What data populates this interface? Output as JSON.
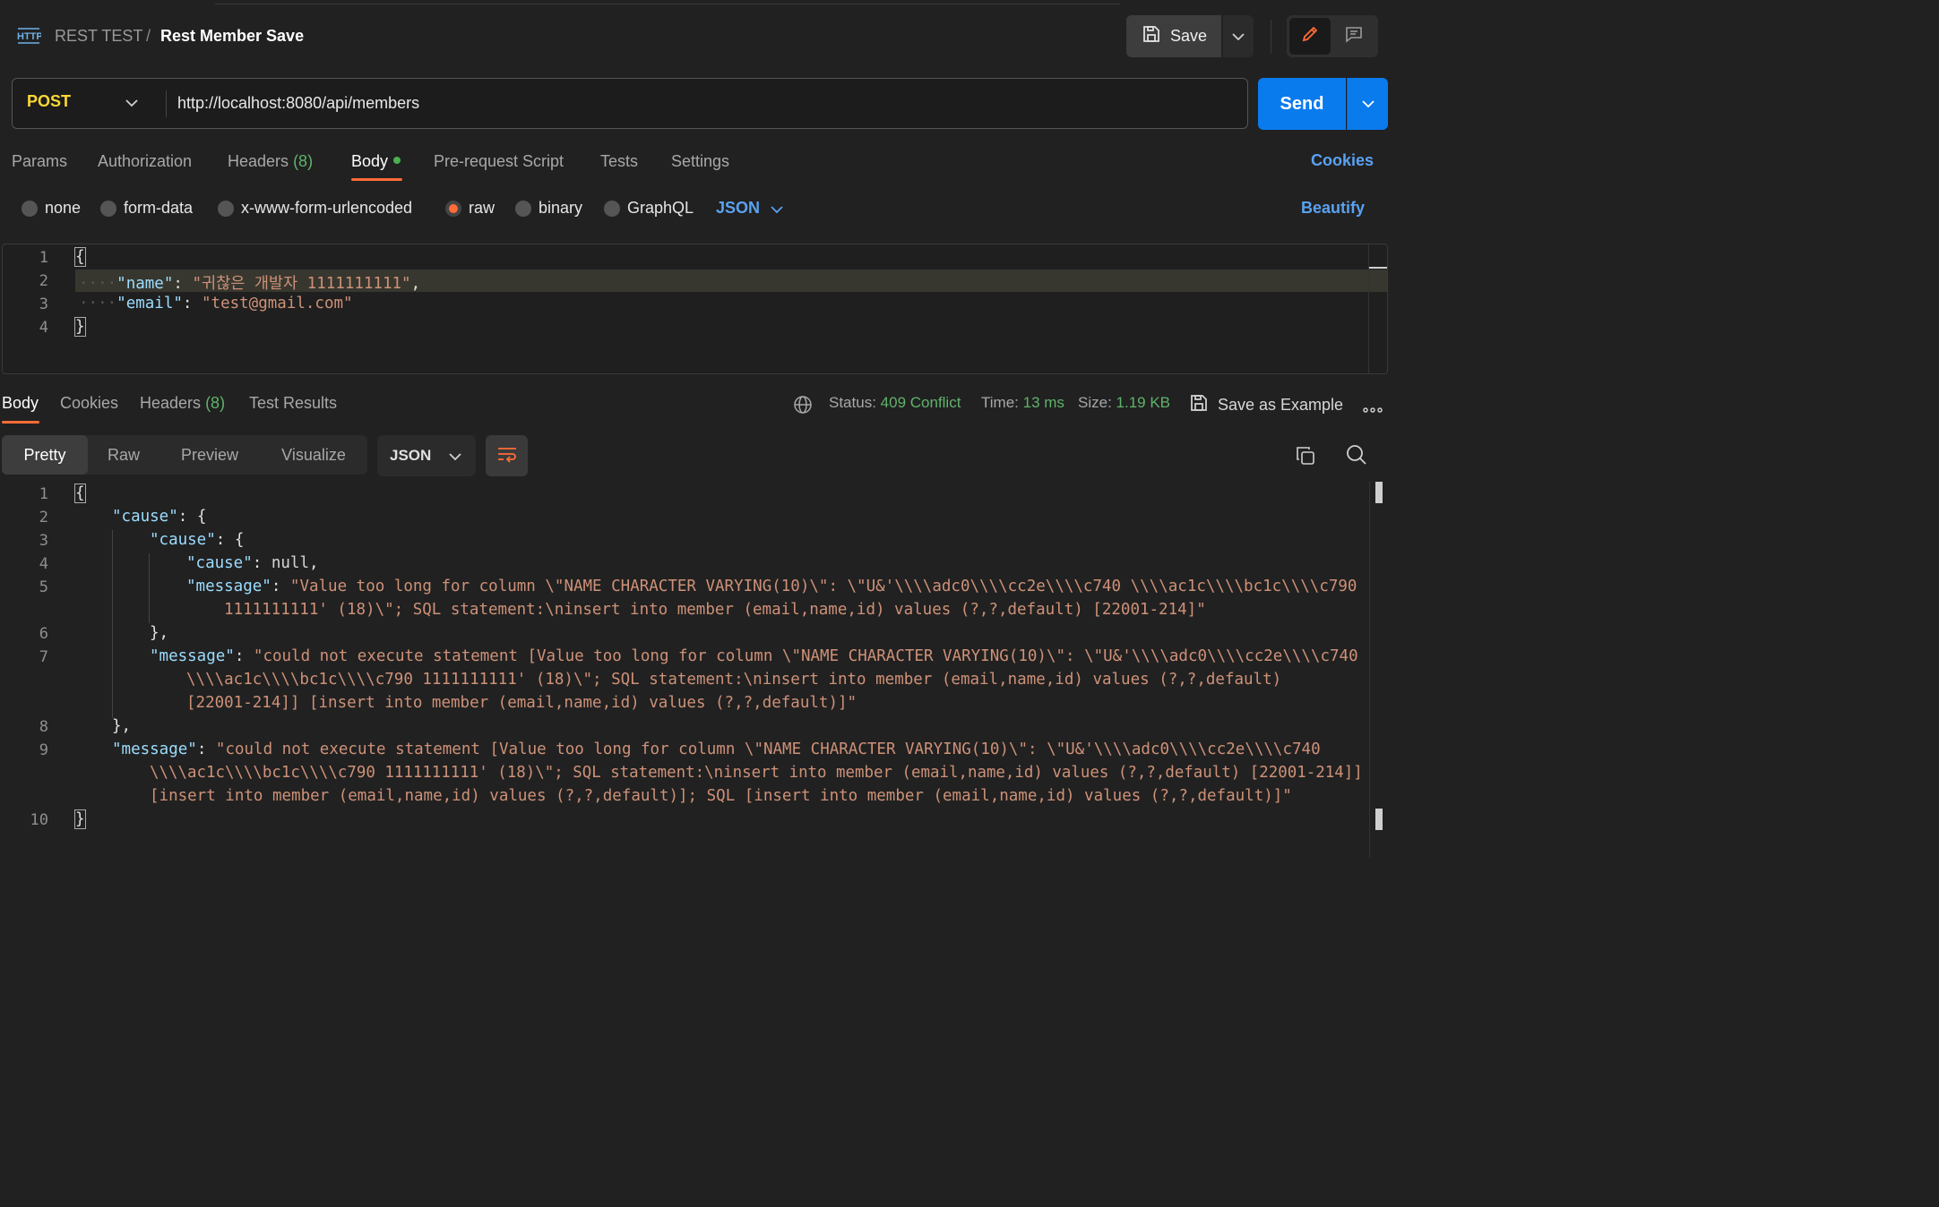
{
  "header": {
    "collection": "REST TEST",
    "separator": "/",
    "request_name": "Rest Member Save",
    "save_label": "Save"
  },
  "request": {
    "method": "POST",
    "url": "http://localhost:8080/api/members",
    "send_label": "Send"
  },
  "request_tabs": {
    "params": "Params",
    "authorization": "Authorization",
    "headers": "Headers",
    "headers_count": "(8)",
    "body": "Body",
    "prerequest": "Pre-request Script",
    "tests": "Tests",
    "settings": "Settings",
    "cookies": "Cookies"
  },
  "body_types": {
    "none": "none",
    "form_data": "form-data",
    "urlencoded": "x-www-form-urlencoded",
    "raw": "raw",
    "binary": "binary",
    "graphql": "GraphQL",
    "language": "JSON",
    "beautify": "Beautify"
  },
  "request_body": {
    "line_numbers": [
      "1",
      "2",
      "3",
      "4"
    ],
    "open": "{",
    "name_key": "\"name\"",
    "name_val": "\"귀찮은 개발자 1111111111\"",
    "email_key": "\"email\"",
    "email_val": "\"test@gmail.com\"",
    "close": "}"
  },
  "response_tabs": {
    "body": "Body",
    "cookies": "Cookies",
    "headers": "Headers",
    "headers_count": "(8)",
    "test_results": "Test Results"
  },
  "response_meta": {
    "status_label": "Status:",
    "status_value": "409 Conflict",
    "time_label": "Time:",
    "time_value": "13 ms",
    "size_label": "Size:",
    "size_value": "1.19 KB",
    "save_example": "Save as Example"
  },
  "response_view": {
    "pretty": "Pretty",
    "raw": "Raw",
    "preview": "Preview",
    "visualize": "Visualize",
    "format": "JSON"
  },
  "response_body": {
    "line_numbers": [
      "1",
      "2",
      "3",
      "4",
      "5",
      "6",
      "7",
      "8",
      "9",
      "10"
    ],
    "l1": "{",
    "l2_key": "\"cause\"",
    "l2_rest": ": {",
    "l3_key": "\"cause\"",
    "l3_rest": ": {",
    "l4_key": "\"cause\"",
    "l4_rest": ": ",
    "l4_val": "null",
    "l4_end": ",",
    "l5_key": "\"message\"",
    "l5_rest": ": ",
    "l5_val_a": "\"Value too long for column \\\"NAME CHARACTER VARYING(10)\\\": \\\"U&'\\\\\\\\adc0\\\\\\\\cc2e\\\\\\\\c740 \\\\\\\\ac1c\\\\\\\\bc1c\\\\\\\\c790",
    "l5_val_b": "1111111111' (18)\\\"; SQL statement:\\ninsert into member (email,name,id) values (?,?,default) [22001-214]\"",
    "l6": "},",
    "l7_key": "\"message\"",
    "l7_rest": ": ",
    "l7_val_a": "\"could not execute statement [Value too long for column \\\"NAME CHARACTER VARYING(10)\\\": \\\"U&'\\\\\\\\adc0\\\\\\\\cc2e\\\\\\\\c740",
    "l7_val_b": "\\\\\\\\ac1c\\\\\\\\bc1c\\\\\\\\c790 1111111111' (18)\\\"; SQL statement:\\ninsert into member (email,name,id) values (?,?,default)",
    "l7_val_c": "[22001-214]] [insert into member (email,name,id) values (?,?,default)]\"",
    "l8": "},",
    "l9_key": "\"message\"",
    "l9_rest": ": ",
    "l9_val_a": "\"could not execute statement [Value too long for column \\\"NAME CHARACTER VARYING(10)\\\": \\\"U&'\\\\\\\\adc0\\\\\\\\cc2e\\\\\\\\c740",
    "l9_val_b": "\\\\\\\\ac1c\\\\\\\\bc1c\\\\\\\\c790 1111111111' (18)\\\"; SQL statement:\\ninsert into member (email,name,id) values (?,?,default) [22001-214]]",
    "l9_val_c": "[insert into member (email,name,id) values (?,?,default)]; SQL [insert into member (email,name,id) values (?,?,default)]\"",
    "l10": "}"
  },
  "colors": {
    "accent": "#ff6c37",
    "send": "#097bed",
    "link": "#5aa2f0",
    "status_ok": "#5fb36a",
    "method_post": "#fdd835"
  },
  "icons": [
    "http-icon",
    "save-icon",
    "chevron-down-icon",
    "pencil-icon",
    "comment-icon",
    "globe-icon",
    "more-icon",
    "wrap-lines-icon",
    "copy-icon",
    "search-icon"
  ]
}
